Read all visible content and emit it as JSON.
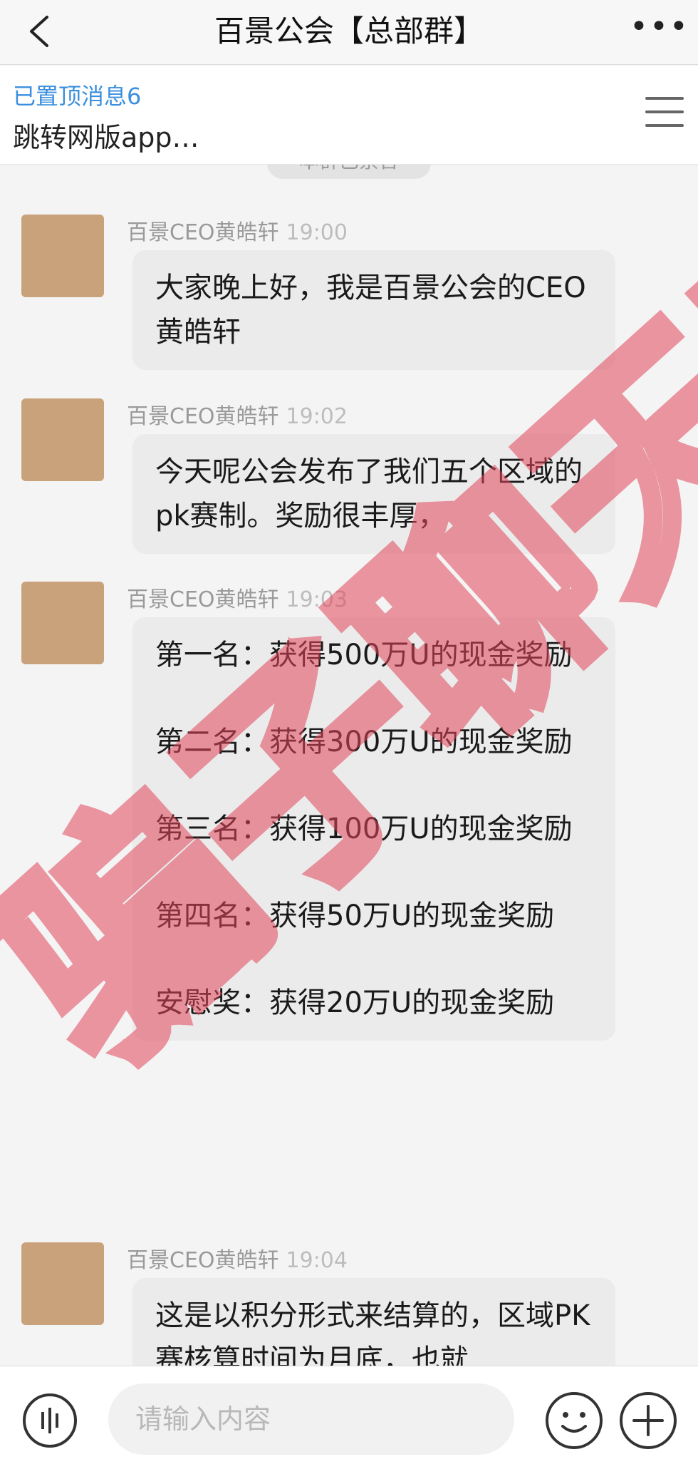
{
  "header": {
    "title": "百景公会【总部群】",
    "back_icon": "chevron-left-icon",
    "more_label": "•••"
  },
  "pinned": {
    "title": "已置顶消息6",
    "preview": "跳转网版app…",
    "menu_icon": "hamburger-menu-icon"
  },
  "chat": {
    "system_tip": "本群已禁言",
    "messages": [
      {
        "sender": "百景CEO黄皓轩",
        "time": "19:00",
        "paragraphs": [
          "大家晚上好，我是百景公会的CEO　黄皓轩"
        ]
      },
      {
        "sender": "百景CEO黄皓轩",
        "time": "19:02",
        "paragraphs": [
          "今天呢公会发布了我们五个区域的pk赛制。奖励很丰厚，"
        ]
      },
      {
        "sender": "百景CEO黄皓轩",
        "time": "19:03",
        "paragraphs": [
          "第一名：获得500万U的现金奖励",
          "第二名：获得300万U的现金奖励",
          "第三名：获得100万U的现金奖励",
          "第四名：获得50万U的现金奖励",
          "安慰奖：获得20万U的现金奖励"
        ]
      },
      {
        "sender": "百景CEO黄皓轩",
        "time": "19:04",
        "paragraphs": [
          "这是以积分形式来结算的，区域PK赛核算时间为月底，也就"
        ]
      }
    ]
  },
  "input": {
    "placeholder": "请输入内容",
    "voice_icon": "voice-icon",
    "emoji_icon": "emoji-icon",
    "plus_icon": "plus-icon"
  },
  "watermark": {
    "text": "骗子聊天截图"
  },
  "colors": {
    "pinned_title": "#3a8fde",
    "bubble": "#ebebeb",
    "watermark": "#e0455a"
  }
}
